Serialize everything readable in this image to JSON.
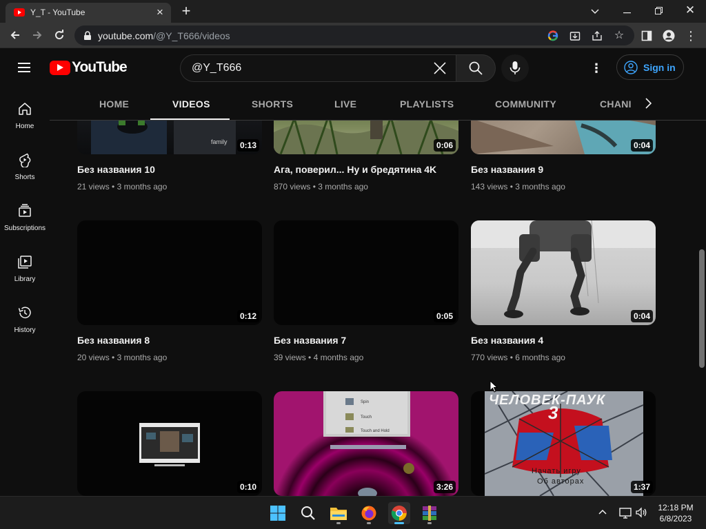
{
  "browser": {
    "tab_title": "Y_T - YouTube",
    "url_host": "youtube.com",
    "url_path": "/@Y_T666/videos"
  },
  "masthead": {
    "logo_text": "YouTube",
    "search_value": "@Y_T666",
    "signin_label": "Sign in"
  },
  "guide": {
    "items": [
      {
        "label": "Home",
        "icon": "home-icon"
      },
      {
        "label": "Shorts",
        "icon": "shorts-icon"
      },
      {
        "label": "Subscriptions",
        "icon": "subscriptions-icon"
      },
      {
        "label": "Library",
        "icon": "library-icon"
      },
      {
        "label": "History",
        "icon": "history-icon"
      }
    ]
  },
  "channel_tabs": {
    "items": [
      "HOME",
      "VIDEOS",
      "SHORTS",
      "LIVE",
      "PLAYLISTS",
      "COMMUNITY",
      "CHANNELS"
    ],
    "visible_last": "CHANI",
    "active": "VIDEOS"
  },
  "videos": [
    {
      "title": "Без названия 10",
      "views": "21 views",
      "age": "3 months ago",
      "duration": "0:13"
    },
    {
      "title": "Ага, поверил... Ну и бредятина 4K",
      "views": "870 views",
      "age": "3 months ago",
      "duration": "0:06"
    },
    {
      "title": "Без названия 9",
      "views": "143 views",
      "age": "3 months ago",
      "duration": "0:04"
    },
    {
      "title": "Без названия 8",
      "views": "20 views",
      "age": "3 months ago",
      "duration": "0:12"
    },
    {
      "title": "Без названия 7",
      "views": "39 views",
      "age": "4 months ago",
      "duration": "0:05"
    },
    {
      "title": "Без названия 4",
      "views": "770 views",
      "age": "6 months ago",
      "duration": "0:04"
    },
    {
      "title": "",
      "views": "",
      "age": "",
      "duration": "0:10"
    },
    {
      "title": "",
      "views": "",
      "age": "",
      "duration": "3:26"
    },
    {
      "title": "",
      "views": "",
      "age": "",
      "duration": "1:37"
    }
  ],
  "thumb_text": {
    "family_watermark": "family",
    "spiderman_title": "ЧЕЛОВЕК-ПАУК",
    "spiderman_number": "3",
    "spiderman_menu_1": "Начать игру",
    "spiderman_menu_2": "Об авторах",
    "game_menu_1": "Spin",
    "game_menu_2": "Touch",
    "game_menu_3": "Touch and Hold"
  },
  "taskbar": {
    "time": "12:18 PM",
    "date": "6/8/2023",
    "apps": [
      "start-icon",
      "search-icon",
      "file-explorer-icon",
      "firefox-icon",
      "chrome-icon",
      "winrar-icon"
    ]
  },
  "colors": {
    "youtube_red": "#ff0000",
    "signin_blue": "#3ea6ff",
    "background": "#0f0f0f"
  }
}
